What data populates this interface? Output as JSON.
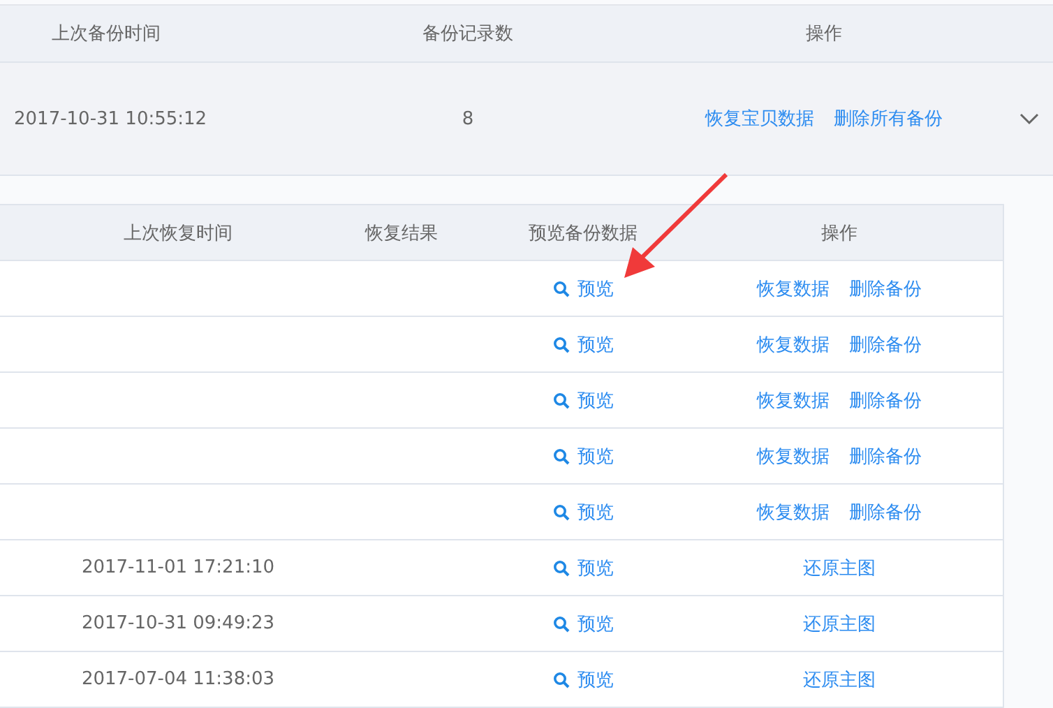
{
  "backup_table": {
    "columns": [
      "上次备份时间",
      "备份记录数",
      "操作"
    ],
    "rows": [
      {
        "backup_time": "2017-10-31 10:55:12",
        "count": "8",
        "actions": [
          "恢复宝贝数据",
          "删除所有备份"
        ],
        "expanded": true
      }
    ]
  },
  "records_table": {
    "columns": [
      "上次恢复时间",
      "恢复结果",
      "预览备份数据",
      "操作"
    ],
    "rows": [
      {
        "preview": "预览",
        "actions": [
          "恢复数据",
          "删除备份"
        ]
      },
      {
        "preview": "预览",
        "actions": [
          "恢复数据",
          "删除备份"
        ]
      },
      {
        "preview": "预览",
        "actions": [
          "恢复数据",
          "删除备份"
        ]
      },
      {
        "preview": "预览",
        "actions": [
          "恢复数据",
          "删除备份"
        ]
      },
      {
        "preview": "预览",
        "actions": [
          "恢复数据",
          "删除备份"
        ]
      },
      {
        "restore_time": "2017-11-01 17:21:10",
        "preview": "预览",
        "actions": [
          "还原主图"
        ]
      },
      {
        "restore_time": "2017-10-31 09:49:23",
        "preview": "预览",
        "actions": [
          "还原主图"
        ]
      },
      {
        "restore_time": "2017-07-04 11:38:03",
        "preview": "预览",
        "actions": [
          "还原主图"
        ]
      }
    ]
  }
}
